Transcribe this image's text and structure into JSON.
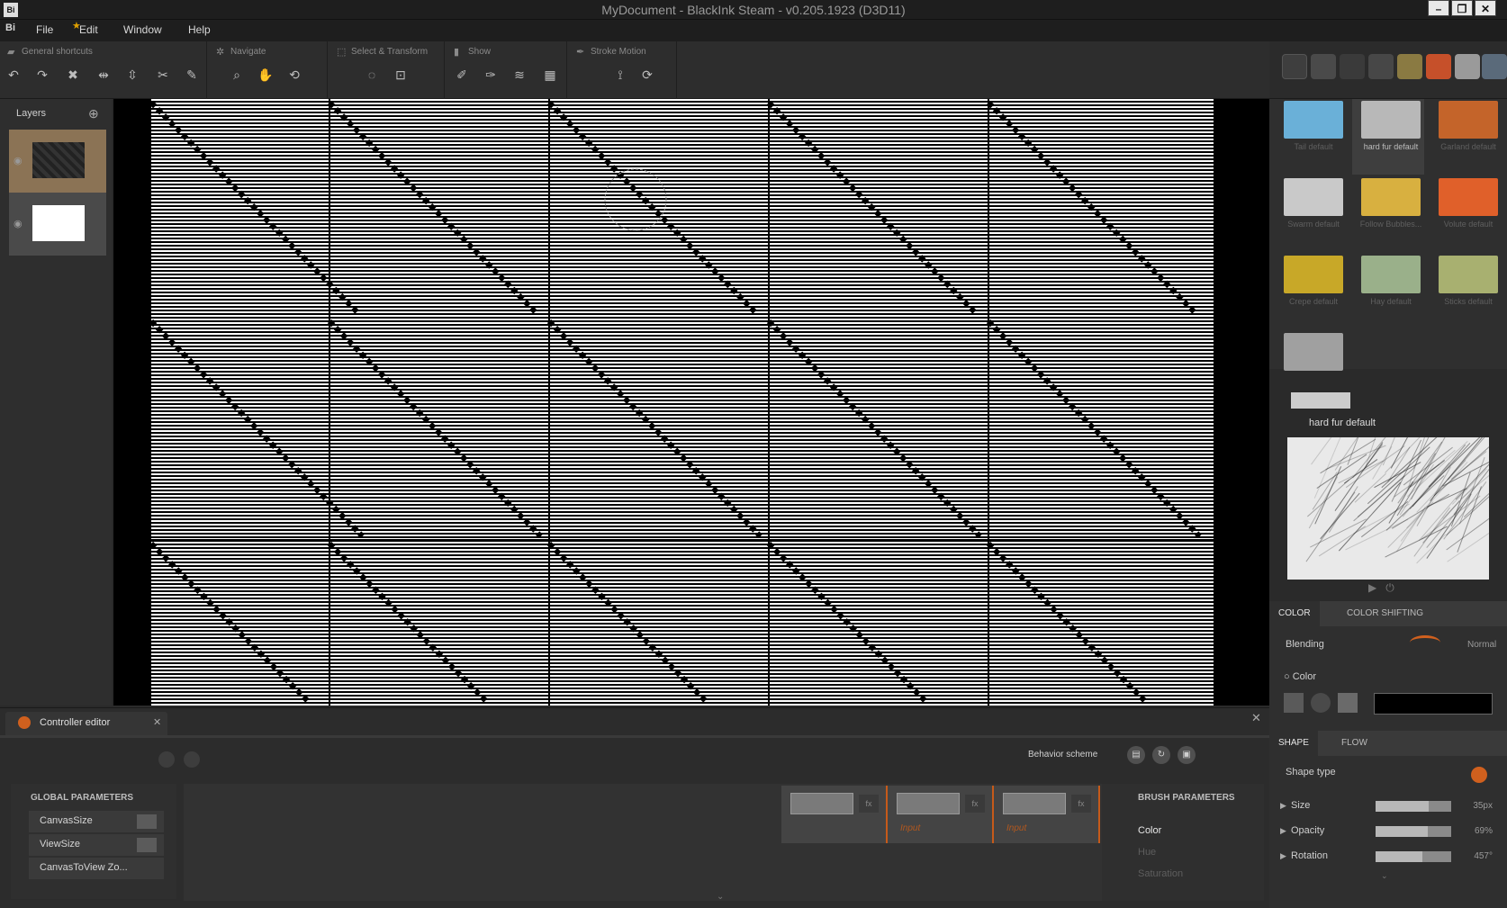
{
  "window": {
    "app_icon": "Bi",
    "title": "MyDocument - BlackInk Steam - v0.205.1923 (D3D11)",
    "controls": [
      "minimize",
      "restore",
      "close"
    ]
  },
  "menubar": {
    "logo": "Bi",
    "items": [
      "File",
      "Edit",
      "Window",
      "Help"
    ]
  },
  "toolbar": {
    "groups": [
      {
        "title": "General shortcuts",
        "tools": [
          "undo-icon",
          "redo-icon",
          "delete-icon",
          "flip-horizontal-icon",
          "flip-vertical-icon",
          "scissors-icon",
          "fill-icon"
        ]
      },
      {
        "title": "Navigate",
        "tools": [
          "zoom-icon",
          "pan-hand-icon",
          "rotate-hand-icon"
        ]
      },
      {
        "title": "Select & Transform",
        "tools": [
          "lasso-select-icon",
          "transform-icon"
        ]
      },
      {
        "title": "Show",
        "tools": [
          "brush-show-icon",
          "brush-edit-icon",
          "layers-show-icon",
          "grid-show-icon"
        ]
      },
      {
        "title": "Stroke Motion",
        "tools": [
          "stroke-icon",
          "motion-icon"
        ]
      }
    ]
  },
  "layers": {
    "title": "Layers"
  },
  "brushes": {
    "grid": [
      {
        "label": "Tail default",
        "color": "#6ab0d8",
        "selected": false
      },
      {
        "label": "hard fur default",
        "color": "#b8b8b8",
        "selected": true
      },
      {
        "label": "Garland default",
        "color": "#c4642a",
        "selected": false
      },
      {
        "label": "Swarm default",
        "color": "#c9c9c9",
        "selected": false
      },
      {
        "label": "Follow Bubbles...",
        "color": "#d8b040",
        "selected": false
      },
      {
        "label": "Volute default",
        "color": "#e0602a",
        "selected": false
      },
      {
        "label": "Crepe default",
        "color": "#c8a828",
        "selected": false
      },
      {
        "label": "Hay default",
        "color": "#9ab08a",
        "selected": false
      },
      {
        "label": "Sticks default",
        "color": "#a8b070",
        "selected": false
      },
      {
        "label": "",
        "color": "#a0a0a0",
        "selected": false
      }
    ],
    "selected_name": "hard fur default"
  },
  "color_tabs": [
    "COLOR",
    "COLOR SHIFTING"
  ],
  "color_panel": {
    "blending_label": "Blending",
    "blending_value": "Normal",
    "color_label": "Color",
    "color_swatch": "#000000"
  },
  "shape_tabs": [
    "SHAPE",
    "FLOW"
  ],
  "shape_panel": {
    "shape_type_label": "Shape type",
    "accent": "#d0601e",
    "props": [
      {
        "label": "Size",
        "value": "35px",
        "fill": 0.7
      },
      {
        "label": "Opacity",
        "value": "69%",
        "fill": 0.69
      },
      {
        "label": "Rotation",
        "value": "457°",
        "fill": 0.62
      }
    ]
  },
  "controller": {
    "tab_title": "Controller editor",
    "behavior_label": "Behavior scheme",
    "global_title": "GLOBAL PARAMETERS",
    "global_params": [
      "CanvasSize",
      "ViewSize",
      "CanvasToView Zo..."
    ],
    "nodes": [
      {
        "input": ""
      },
      {
        "input": "Input"
      },
      {
        "input": "Input"
      }
    ],
    "brush_params_title": "BRUSH PARAMETERS",
    "brush_params": [
      {
        "label": "Color",
        "active": true
      },
      {
        "label": "Hue",
        "active": false
      },
      {
        "label": "Saturation",
        "active": false
      }
    ]
  }
}
